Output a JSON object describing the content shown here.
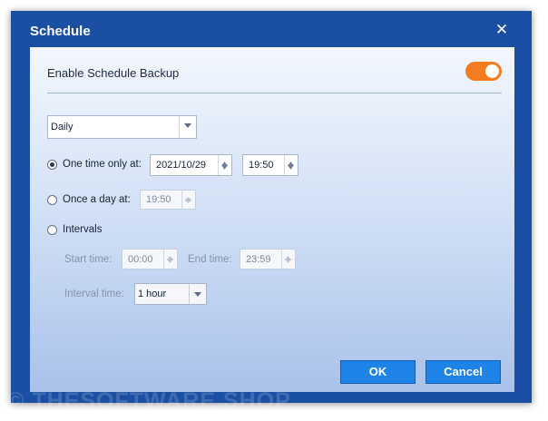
{
  "dialog": {
    "title": "Schedule",
    "close_glyph": "✕"
  },
  "enable_schedule": {
    "label": "Enable Schedule Backup",
    "on": true,
    "accent_color": "#f47b20"
  },
  "frequency": {
    "selected": "Daily"
  },
  "one_time": {
    "label": "One time only at:",
    "selected": true,
    "date": "2021/10/29",
    "time": "19:50"
  },
  "once_a_day": {
    "label": "Once a day at:",
    "selected": false,
    "time": "19:50"
  },
  "intervals": {
    "label": "Intervals",
    "selected": false,
    "start_label": "Start time:",
    "start_time": "00:00",
    "end_label": "End time:",
    "end_time": "23:59",
    "interval_label": "Interval time:",
    "interval_value": "1 hour"
  },
  "buttons": {
    "ok": "OK",
    "cancel": "Cancel",
    "color": "#1e84e8"
  },
  "watermark": "© THESOFTWARE.SHOP"
}
